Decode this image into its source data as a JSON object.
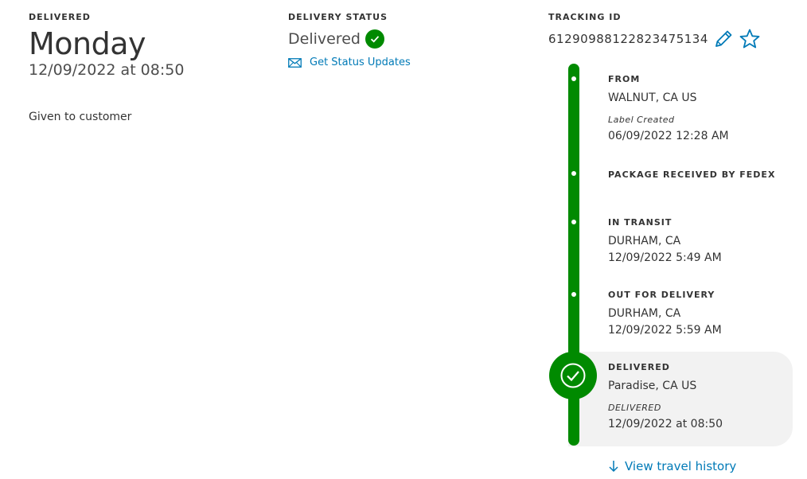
{
  "summary": {
    "delivered_caption": "DELIVERED",
    "day": "Monday",
    "datetime": "12/09/2022 at 08:50",
    "note": "Given to customer"
  },
  "status": {
    "caption": "DELIVERY STATUS",
    "value": "Delivered",
    "updates_link": "Get Status Updates",
    "status_color": "#008a00",
    "link_color": "#007ab7"
  },
  "tracking": {
    "caption": "TRACKING ID",
    "number": "612909881228234751​34"
  },
  "timeline": [
    {
      "title": "FROM",
      "location": "WALNUT, CA US",
      "info_label": "Label Created",
      "time": "06/09/2022 12:28 AM"
    },
    {
      "title": "PACKAGE RECEIVED BY FEDEX"
    },
    {
      "title": "IN TRANSIT",
      "location": "DURHAM, CA",
      "time": "12/09/2022 5:49 AM"
    },
    {
      "title": "OUT FOR DELIVERY",
      "location": "DURHAM, CA",
      "time": "12/09/2022 5:59 AM"
    },
    {
      "title": "DELIVERED",
      "location": "Paradise, CA US",
      "info_label": "DELIVERED",
      "time": "12/09/2022 at 08:50"
    }
  ],
  "travel_history_link": "View travel history",
  "icons": [
    "check-circle-icon",
    "envelope-icon",
    "pencil-icon",
    "star-icon",
    "arrow-down-icon"
  ]
}
